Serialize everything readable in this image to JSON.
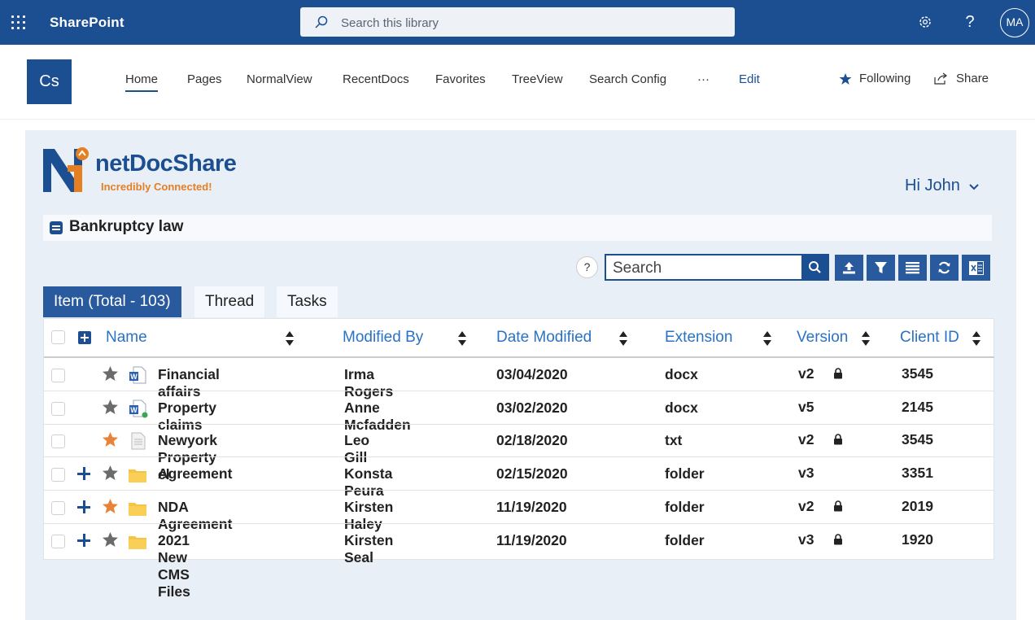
{
  "suite": {
    "app_name": "SharePoint",
    "search_placeholder": "Search this library",
    "avatar_initials": "MA"
  },
  "site": {
    "logo_text": "Cs",
    "nav": [
      "Home",
      "Pages",
      "NormalView",
      "RecentDocs",
      "Favorites",
      "TreeView",
      "Search Config",
      "···",
      "Edit"
    ],
    "following_label": "Following",
    "share_label": "Share"
  },
  "app": {
    "brand_name": "netDocShare",
    "tagline": "Incredibly Connected!",
    "greeting": "Hi John",
    "library_title": "Bankruptcy law",
    "search_value": "Search",
    "help": "?",
    "tabs": [
      "Item (Total - 103)",
      "Thread",
      "Tasks"
    ],
    "columns": [
      "Name",
      "Modified By",
      "Date Modified",
      "Extension",
      "Version",
      "Client ID"
    ],
    "rows": [
      {
        "name": "Financial affairs",
        "modified_by": "Irma Rogers",
        "date": "03/04/2020",
        "ext": "docx",
        "version": "v2",
        "client_id": "3545",
        "locked": true,
        "favorite": false,
        "expandable": false,
        "type": "word"
      },
      {
        "name": "Property claims",
        "modified_by": "Anne Mcfadden",
        "date": "03/02/2020",
        "ext": "docx",
        "version": "v5",
        "client_id": "2145",
        "locked": false,
        "favorite": false,
        "expandable": false,
        "type": "word-synced"
      },
      {
        "name": "Newyork Property cl",
        "modified_by": "Leo Gill",
        "date": "02/18/2020",
        "ext": "txt",
        "version": "v2",
        "client_id": "3545",
        "locked": true,
        "favorite": true,
        "expandable": false,
        "type": "txt"
      },
      {
        "name": "Agreement",
        "modified_by": "Konsta Peura",
        "date": "02/15/2020",
        "ext": "folder",
        "version": "v3",
        "client_id": "3351",
        "locked": false,
        "favorite": false,
        "expandable": true,
        "type": "folder"
      },
      {
        "name": "NDA Agreement",
        "modified_by": "Kirsten Haley",
        "date": "11/19/2020",
        "ext": "folder",
        "version": "v2",
        "client_id": "2019",
        "locked": true,
        "favorite": true,
        "expandable": true,
        "type": "folder"
      },
      {
        "name": "2021 New CMS Files",
        "modified_by": "Kirsten Seal",
        "date": "11/19/2020",
        "ext": "folder",
        "version": "v3",
        "client_id": "1920",
        "locked": true,
        "favorite": false,
        "expandable": true,
        "type": "folder"
      }
    ]
  },
  "colors": {
    "brand_blue": "#1c4e92",
    "accent_orange": "#e67e22",
    "star_grey": "#6b6b6b",
    "star_orange": "#e8833a",
    "folder_yellow": "#f6c343"
  }
}
